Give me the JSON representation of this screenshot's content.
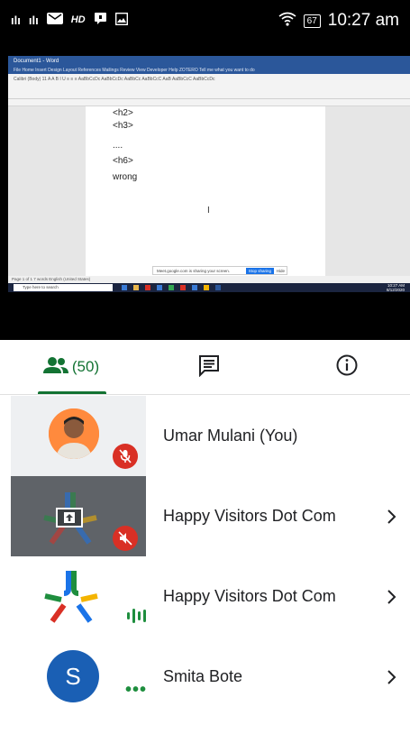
{
  "status_bar": {
    "signal_1": "ılı",
    "signal_2": "ılı",
    "hd": "HD",
    "battery": "67",
    "time": "10:27 am"
  },
  "shared_screen": {
    "window_title": "Document1 - Word",
    "menu": "File  Home  Insert  Design  Layout  References  Mailings  Review  View  Developer  Help  ZOTERO  Tell me what you want to do",
    "ribbon": "Calibri (Body)  11  A A   B I U   ≡ ≡ ≡   AaBbCcDc  AaBbCcDc  AaBbCc  AaBbCcC  AaB  AaBbCcC  AaBbCcDc",
    "doc_lines": [
      "<h2>",
      "<h3>",
      "....",
      "<h6>",
      "wrong"
    ],
    "share_notice": "Meet.google.com is sharing your screen.",
    "stop_sharing": "Stop sharing",
    "hide": "Hide",
    "status": "Page 1 of 1   7 words   English (United States)",
    "taskbar_search": "Type here to search",
    "clock_time": "10:27 AM",
    "clock_date": "8/12/2020"
  },
  "tabs": {
    "people_count": "(50)"
  },
  "participants": [
    {
      "name": "Umar Mulani (You)",
      "muted": true
    },
    {
      "name": "Happy Visitors Dot Com",
      "muted": true,
      "presenting": true
    },
    {
      "name": "Happy Visitors Dot Com",
      "speaking": true
    },
    {
      "name": "Smita Bote",
      "initial": "S"
    }
  ],
  "colors": {
    "accent_green": "#137333",
    "mute_red": "#d93025",
    "avatar_blue": "#1a5fb4",
    "presenting_tile": "#5f6368"
  }
}
